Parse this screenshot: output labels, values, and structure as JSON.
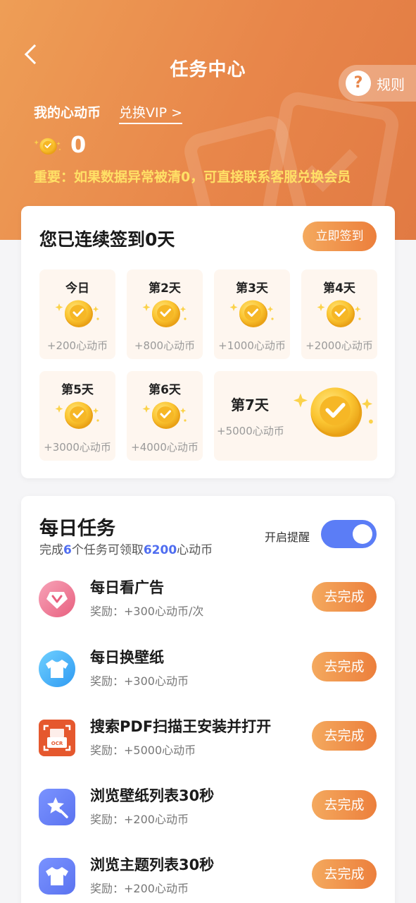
{
  "header": {
    "title": "任务中心",
    "rules_label": "规则",
    "rules_icon": "question-icon",
    "back_icon": "back-arrow-icon",
    "my_coins_label": "我的心动币",
    "exchange_label": "兑换VIP >",
    "coin_balance": "0",
    "notice": "重要：如果数据异常被清0，可直接联系客服兑换会员",
    "notice_color": "#ffe066",
    "gradient_colors": [
      "#ee9e56",
      "#e17a43"
    ]
  },
  "checkin": {
    "title": "您已连续签到0天",
    "button_label": "立即签到",
    "days": [
      {
        "label": "今日",
        "reward": "+200心动币"
      },
      {
        "label": "第2天",
        "reward": "+800心动币"
      },
      {
        "label": "第3天",
        "reward": "+1000心动币"
      },
      {
        "label": "第4天",
        "reward": "+2000心动币"
      },
      {
        "label": "第5天",
        "reward": "+3000心动币"
      },
      {
        "label": "第6天",
        "reward": "+4000心动币"
      },
      {
        "label": "第7天",
        "reward": "+5000心动币"
      }
    ]
  },
  "daily_tasks": {
    "title": "每日任务",
    "subtitle_prefix": "完成",
    "task_count": "6",
    "subtitle_mid": "个任务可领取",
    "total_reward": "6200",
    "subtitle_suffix": "心动币",
    "reminder_label": "开启提醒",
    "reminder_on": true,
    "accent_color": "#5b7df6",
    "tasks": [
      {
        "name": "每日看广告",
        "reward": "奖励：+300心动币/次",
        "button": "去完成",
        "icon": "ad-video-icon"
      },
      {
        "name": "每日换壁纸",
        "reward": "奖励：+300心动币",
        "button": "去完成",
        "icon": "tshirt-icon"
      },
      {
        "name": "搜索PDF扫描王安装并打开",
        "reward": "奖励：+5000心动币",
        "button": "去完成",
        "icon": "ocr-scanner-icon"
      },
      {
        "name": "浏览壁纸列表30秒",
        "reward": "奖励：+200心动币",
        "button": "去完成",
        "icon": "magic-wand-icon"
      },
      {
        "name": "浏览主题列表30秒",
        "reward": "奖励：+200心动币",
        "button": "去完成",
        "icon": "theme-shirt-icon"
      }
    ]
  }
}
